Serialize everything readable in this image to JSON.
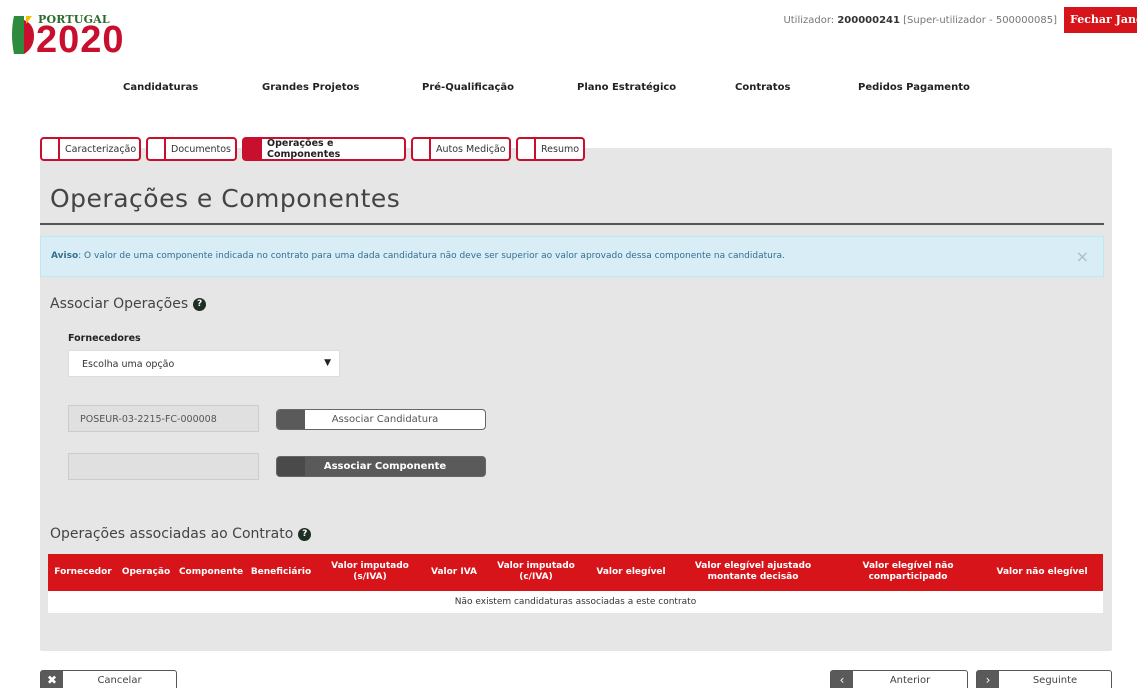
{
  "header": {
    "brand_small": "PORTUGAL",
    "brand_big": "2020",
    "user_prefix": "Utilizador: ",
    "user_id": "200000241",
    "user_role": " [Super-utilizador - 500000085]",
    "close_label": "Fechar Janela"
  },
  "nav": {
    "items": [
      "Candidaturas",
      "Grandes Projetos",
      "Pré-Qualificação",
      "Plano Estratégico",
      "Contratos",
      "Pedidos Pagamento"
    ]
  },
  "tabs": {
    "items": [
      "Caracterização",
      "Documentos",
      "Operações e Componentes",
      "Autos Medição",
      "Resumo"
    ],
    "active": "Operações e Componentes"
  },
  "page": {
    "title": "Operações e Componentes"
  },
  "alert": {
    "bold": "Aviso",
    "text": ": O valor de uma componente indicada no contrato para uma dada candidatura não deve ser superior ao valor aprovado dessa componente na candidatura.",
    "close": "×"
  },
  "associar": {
    "heading": "Associar Operações",
    "fornecedores_label": "Fornecedores",
    "select_value": "Escolha uma opção",
    "candidatura_value": "POSEUR-03-2215-FC-000008",
    "associar_candidatura": "Associar Candidatura",
    "componente_value": "",
    "associar_componente": "Associar Componente"
  },
  "table": {
    "heading": "Operações associadas ao Contrato",
    "columns": [
      "Fornecedor",
      "Operação",
      "Componente",
      "Beneficiário",
      "Valor imputado (s/IVA)",
      "Valor IVA",
      "Valor imputado (c/IVA)",
      "Valor elegível",
      "Valor elegível ajustado montante decisão",
      "Valor elegível não comparticipado",
      "Valor não elegível"
    ],
    "empty_message": "Não existem candidaturas associadas a este contrato"
  },
  "footer": {
    "cancel": "Cancelar",
    "previous": "Anterior",
    "next": "Seguinte"
  },
  "colors": {
    "accent": "#d7141a",
    "panel": "#e6e6e6",
    "alert_bg": "#d9edf7"
  }
}
